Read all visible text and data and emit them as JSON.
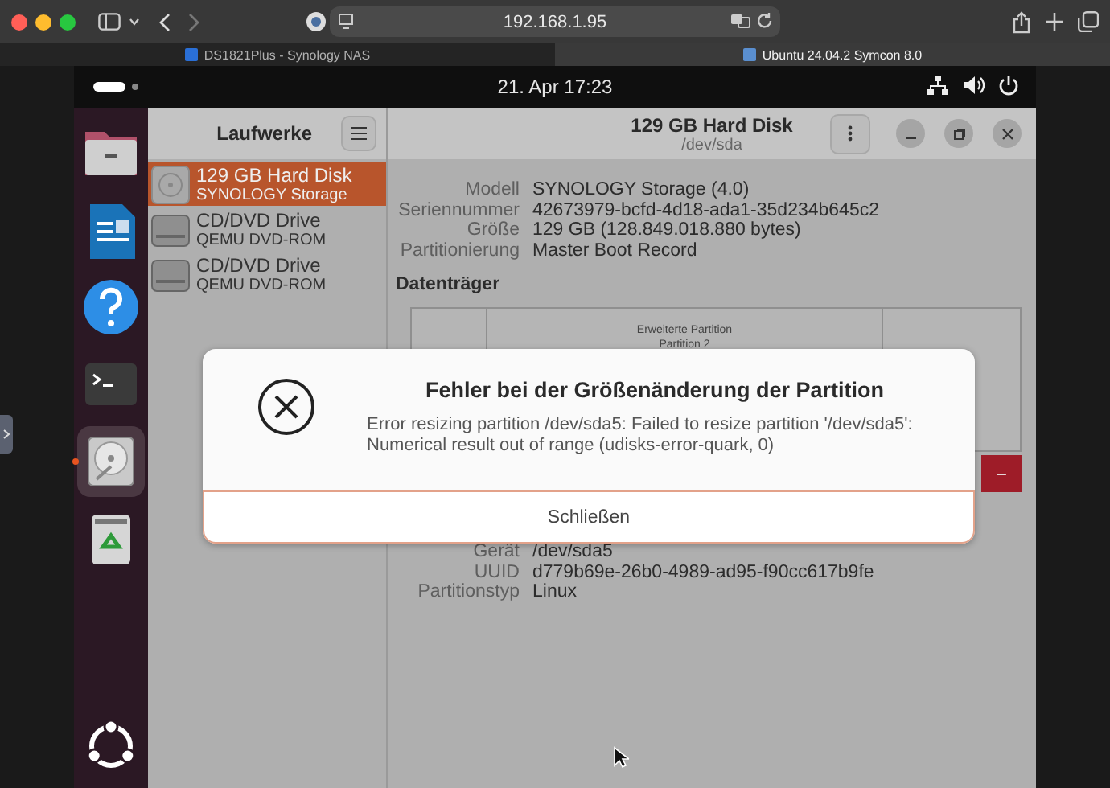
{
  "browser": {
    "address": "192.168.1.95",
    "tabs": [
      {
        "label": "DS1821Plus - Synology NAS",
        "selected": false,
        "kind": "nas"
      },
      {
        "label": "Ubuntu 24.04.2 Symcon 8.0",
        "selected": true,
        "kind": "vm"
      }
    ]
  },
  "topbar": {
    "clock": "21. Apr  17:23"
  },
  "dock": [
    {
      "kind": "files",
      "selected": false,
      "running": false
    },
    {
      "kind": "writer",
      "selected": false,
      "running": false
    },
    {
      "kind": "help",
      "selected": false,
      "running": false
    },
    {
      "kind": "terminal",
      "selected": false,
      "running": false
    },
    {
      "kind": "disks",
      "selected": true,
      "running": true
    },
    {
      "kind": "trash",
      "selected": false,
      "running": false
    },
    {
      "kind": "apps",
      "selected": false,
      "running": false
    }
  ],
  "sidebar": {
    "title": "Laufwerke",
    "drives": [
      {
        "name": "129 GB Hard Disk",
        "detail": "SYNOLOGY Storage",
        "kind": "disk",
        "selected": true
      },
      {
        "name": "CD/DVD Drive",
        "detail": "QEMU DVD-ROM",
        "kind": "optical",
        "selected": false
      },
      {
        "name": "CD/DVD Drive",
        "detail": "QEMU DVD-ROM",
        "kind": "optical",
        "selected": false
      }
    ]
  },
  "header": {
    "title": "129 GB Hard Disk",
    "subtitle": "/dev/sda"
  },
  "disk_info": [
    {
      "label": "Modell",
      "value": "SYNOLOGY Storage (4.0)"
    },
    {
      "label": "Seriennummer",
      "value": "42673979-bcfd-4d18-ada1-35d234b645c2"
    },
    {
      "label": "Größe",
      "value": "129 GB (128.849.018.880 bytes)"
    },
    {
      "label": "Partitionierung",
      "value": "Master Boot Record"
    }
  ],
  "section_title": "Datenträger",
  "partition_map": [
    {
      "kind": "plain"
    },
    {
      "kind": "extended",
      "title": "Erweiterte Partition",
      "subtitle": "Partition 2"
    },
    {
      "kind": "plain"
    }
  ],
  "delete_button": "−",
  "volume_info": [
    {
      "label": "Gerät",
      "value": "/dev/sda5"
    },
    {
      "label": "UUID",
      "value": "d779b69e-26b0-4989-ad95-f90cc617b9fe"
    },
    {
      "label": "Partitionstyp",
      "value": "Linux"
    }
  ],
  "dialog": {
    "title": "Fehler bei der Größenänderung der Partition",
    "message": "Error resizing partition /dev/sda5: Failed to resize partition '/dev/sda5': Numerical result out of range (udisks-error-quark, 0)",
    "button": "Schließen"
  }
}
